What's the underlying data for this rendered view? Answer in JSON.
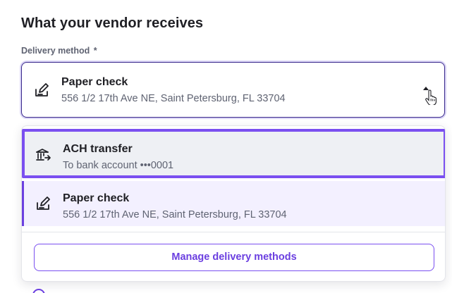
{
  "section": {
    "title": "What your vendor receives"
  },
  "delivery_field": {
    "label": "Delivery method",
    "required_mark": "*",
    "selected": {
      "title": "Paper check",
      "subtitle": "556 1/2 17th Ave NE, Saint Petersburg, FL 33704",
      "icon": "check-writing-icon"
    },
    "caret_icon": "caret-up-icon"
  },
  "dropdown": {
    "options": [
      {
        "title": "ACH transfer",
        "subtitle": "To bank account •••0001",
        "icon": "bank-transfer-icon"
      },
      {
        "title": "Paper check",
        "subtitle": "556 1/2 17th Ave NE, Saint Petersburg, FL 33704",
        "icon": "check-writing-icon"
      }
    ],
    "manage_label": "Manage delivery methods"
  },
  "colors": {
    "accent": "#6b3fe0",
    "highlight_outline": "#7a4ff0",
    "selected_bg": "#f3f0ff",
    "hover_bg": "#eef0f4",
    "border_dark": "#3b2a8c"
  }
}
